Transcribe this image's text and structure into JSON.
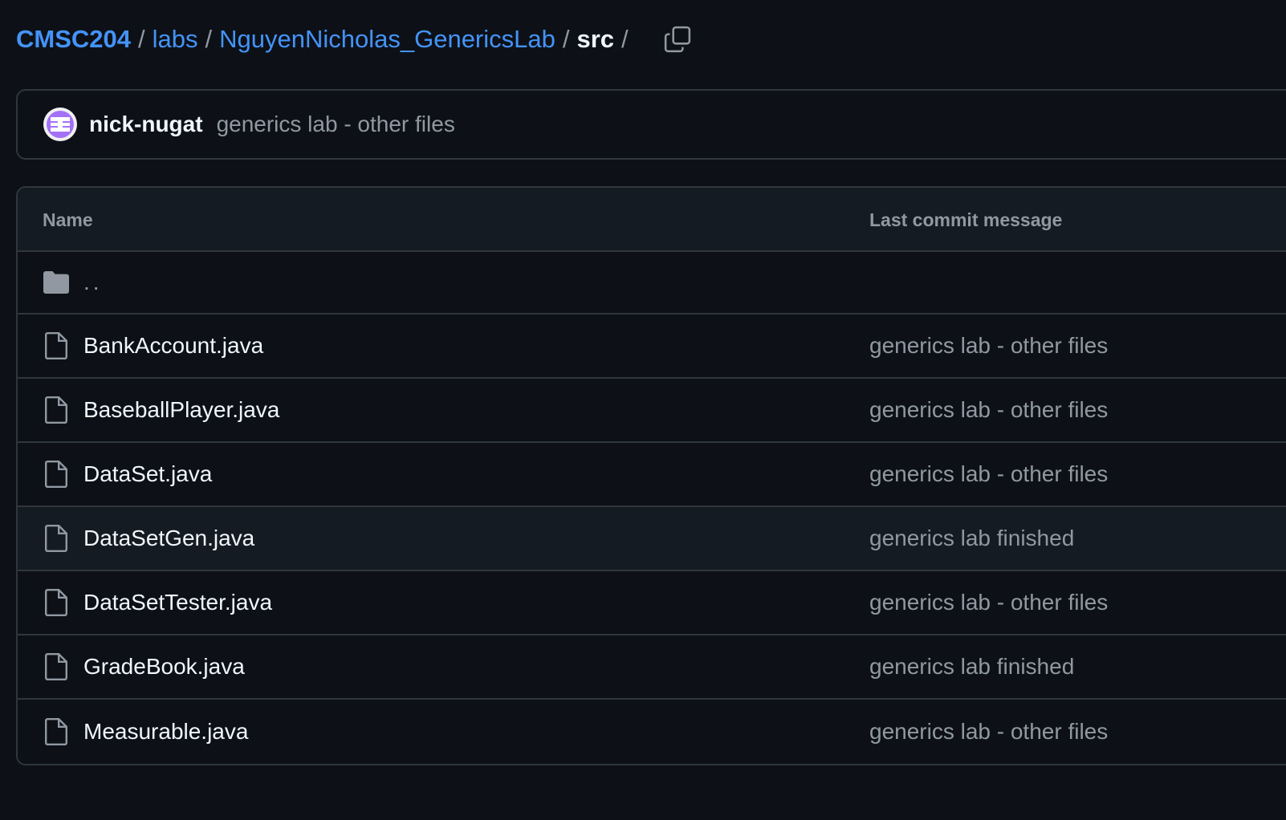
{
  "breadcrumb": {
    "repo": "CMSC204",
    "sep": "/",
    "dirs": [
      "labs",
      "NguyenNicholas_GenericsLab"
    ],
    "current": "src",
    "trailing": "/"
  },
  "latest_commit": {
    "author": "nick-nugat",
    "message": "generics lab - other files"
  },
  "table": {
    "headers": {
      "name": "Name",
      "message": "Last commit message"
    },
    "parent": "..",
    "files": [
      {
        "name": "BankAccount.java",
        "message": "generics lab - other files"
      },
      {
        "name": "BaseballPlayer.java",
        "message": "generics lab - other files"
      },
      {
        "name": "DataSet.java",
        "message": "generics lab - other files"
      },
      {
        "name": "DataSetGen.java",
        "message": "generics lab finished"
      },
      {
        "name": "DataSetTester.java",
        "message": "generics lab - other files"
      },
      {
        "name": "GradeBook.java",
        "message": "generics lab finished"
      },
      {
        "name": "Measurable.java",
        "message": "generics lab - other files"
      }
    ]
  },
  "colors": {
    "background": "#0d1117",
    "link": "#4493f8",
    "muted": "#9198a1",
    "border": "#30363d",
    "avatar": "#a371f7"
  },
  "icons": {
    "copy": "copy-icon",
    "folder": "folder-icon",
    "file": "file-icon",
    "avatar": "identicon"
  }
}
